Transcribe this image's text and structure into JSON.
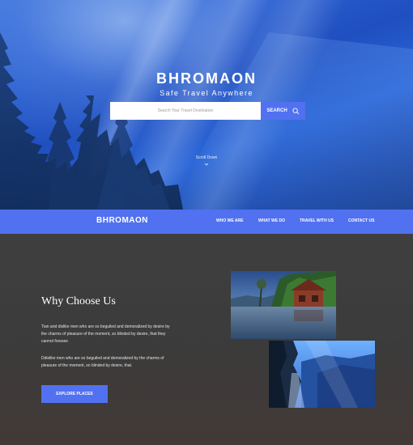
{
  "hero": {
    "brand_title": "BHROMAON",
    "brand_subtitle": "Safe Travel Anywhere",
    "search_placeholder": "Search Your Travel Destination",
    "search_button": "SEARCH",
    "scroll_down": "Scroll Down"
  },
  "nav": {
    "logo": "BHROMAON",
    "links": [
      "WHO WE ARE",
      "WHAT WE DO",
      "TRAVEL WITH US",
      "CONTACT US"
    ]
  },
  "why": {
    "title": "Why Choose Us",
    "paragraph_1_line_1": "Tian and dislike men who are so beguiled and demoralized by desire by",
    "paragraph_1_line_2": "the charms of pleasure of the moment, so blinded by desire, that they",
    "paragraph_1_line_3": "cannot foresee",
    "paragraph_2_line_1": "Ddislike men who are so beguiled and demoralized by the charms of",
    "paragraph_2_line_2": "pleasure of the moment, so blinded by desire, that.",
    "explore_button": "EXPLORE PLACES"
  },
  "colors": {
    "accent": "#5171f0",
    "content_bg": "#3b3b3b"
  }
}
